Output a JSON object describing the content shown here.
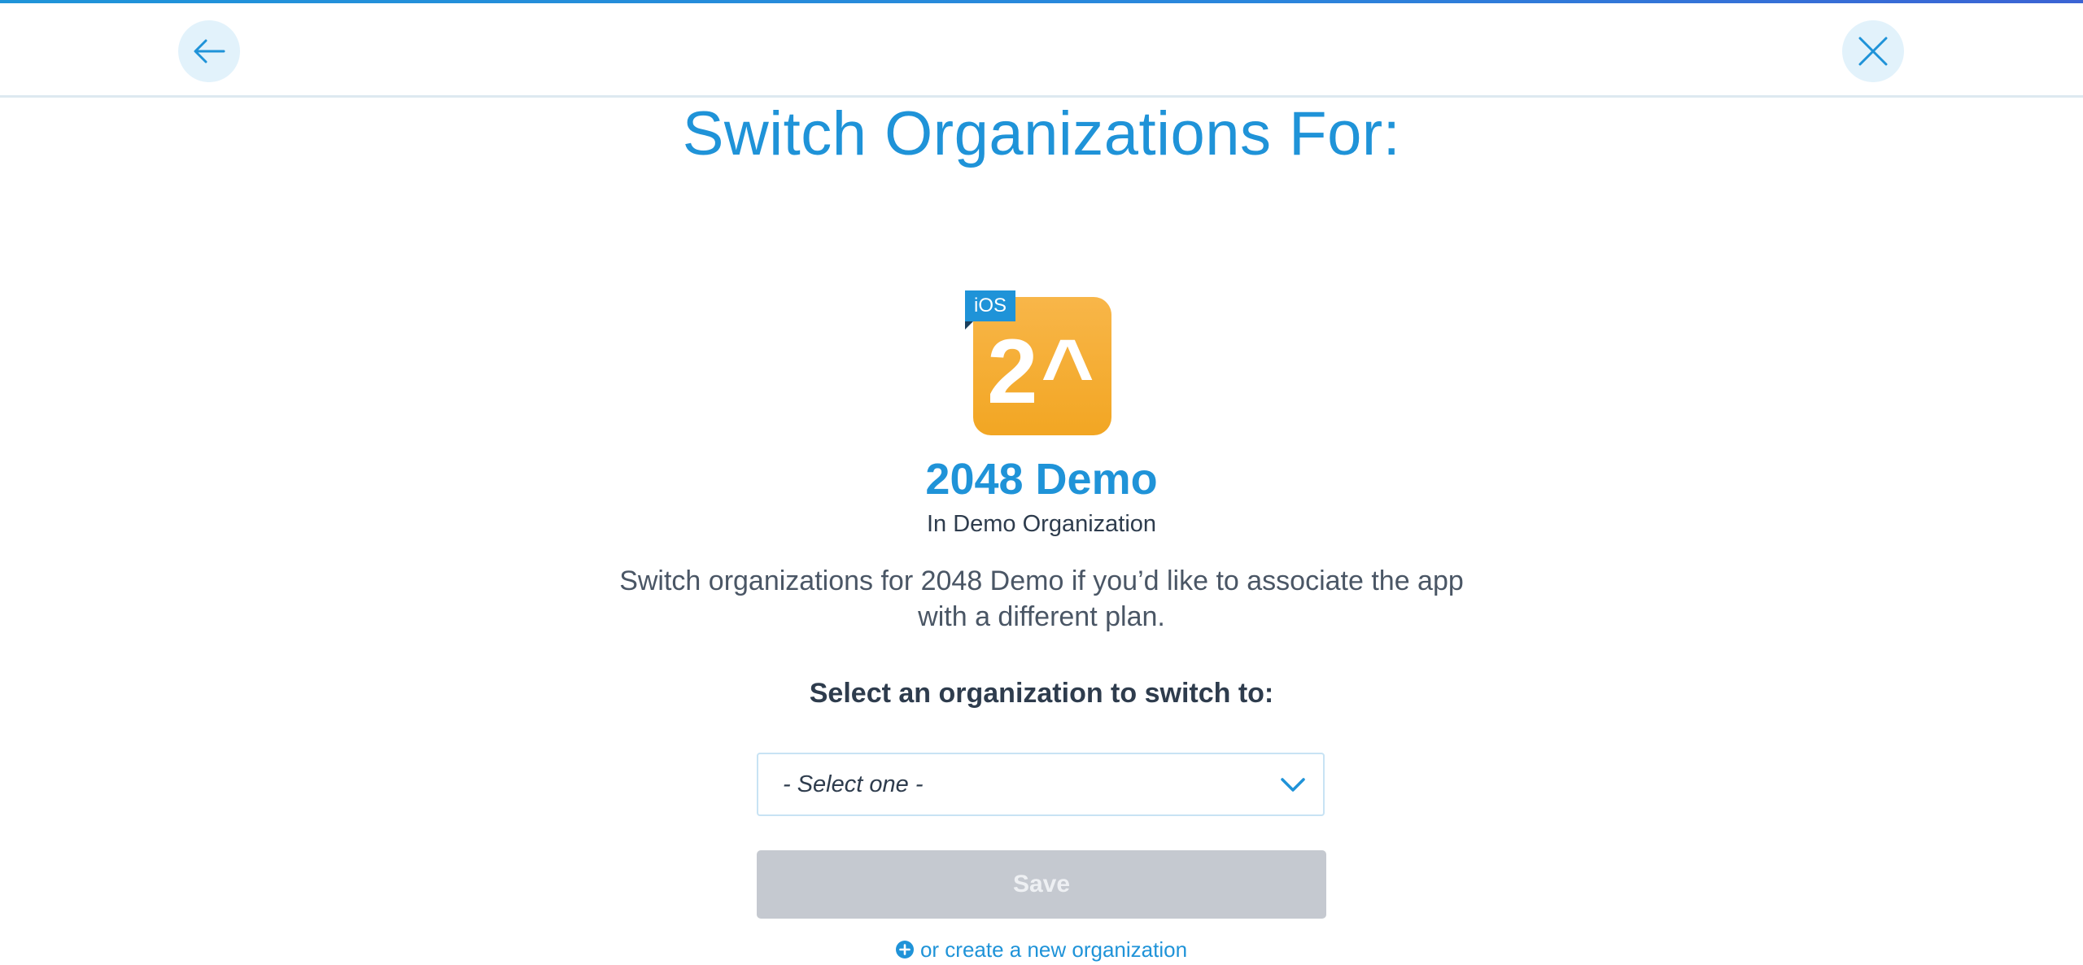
{
  "header": {
    "back_icon": "arrow-left-icon",
    "close_icon": "close-icon"
  },
  "page": {
    "title": "Switch Organizations For:"
  },
  "app": {
    "platform_badge": "iOS",
    "icon_glyph": "2^",
    "name": "2048 Demo",
    "organization": "In Demo Organization"
  },
  "description": "Switch organizations for 2048 Demo if you’d like to associate the app with a different plan.",
  "form": {
    "select_label": "Select an organization to switch to:",
    "select_value": "- Select one -",
    "save_label": "Save",
    "create_link_label": "or create a new organization"
  },
  "colors": {
    "accent": "#1f93d8",
    "icon_bg": "#f2a623",
    "disabled_button": "#c5c9d0",
    "text_dark": "#2e3c4d"
  }
}
